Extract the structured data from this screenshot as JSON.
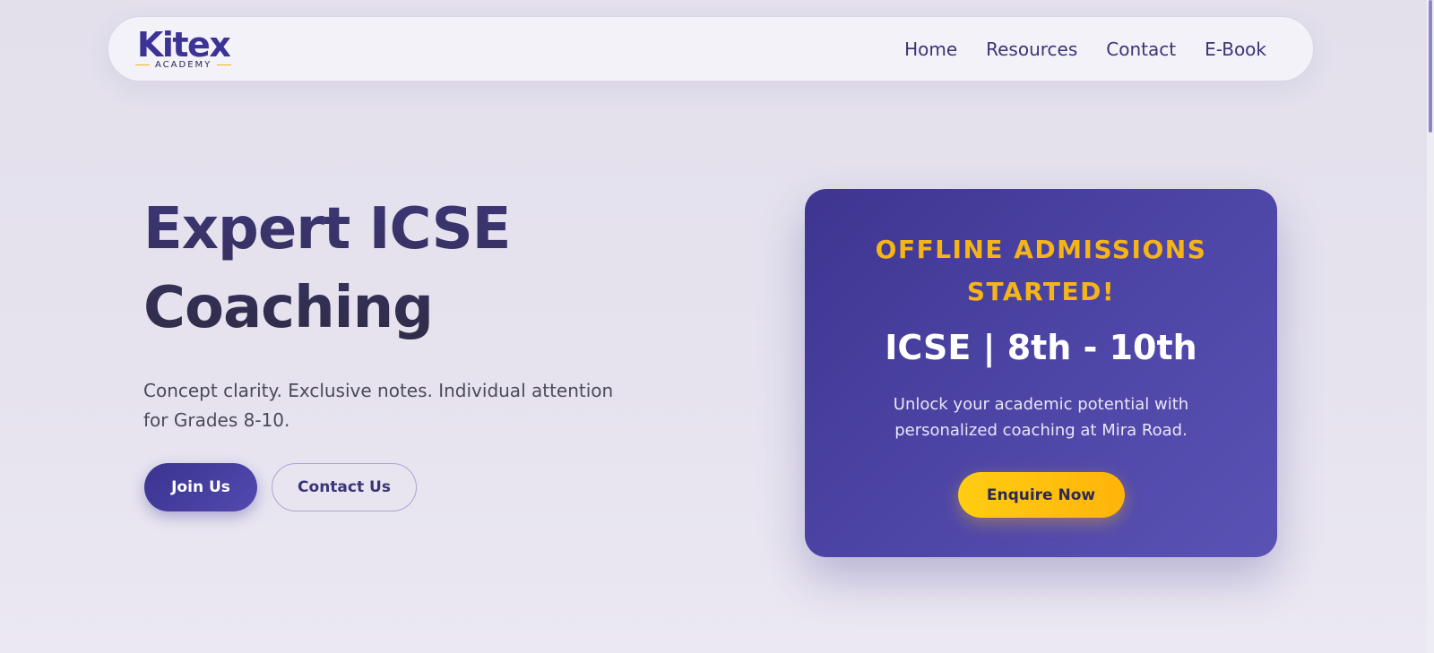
{
  "header": {
    "logo": {
      "word": "Kitex",
      "sub": "ACADEMY"
    },
    "nav": [
      "Home",
      "Resources",
      "Contact",
      "E-Book"
    ]
  },
  "hero": {
    "title_line1": "Expert ICSE",
    "title_line2": "Coaching",
    "subtitle": "Concept clarity. Exclusive notes. Individual attention for Grades 8-10.",
    "primary_button": "Join Us",
    "secondary_button": "Contact Us"
  },
  "card": {
    "eyebrow": "OFFLINE ADMISSIONS STARTED!",
    "title": "ICSE | 8th - 10th",
    "description": "Unlock your academic potential with personalized coaching at Mira Road.",
    "button": "Enquire Now"
  },
  "colors": {
    "brand": "#3d3397",
    "accent": "#f5b517",
    "card_bg": "#4d45a6"
  }
}
